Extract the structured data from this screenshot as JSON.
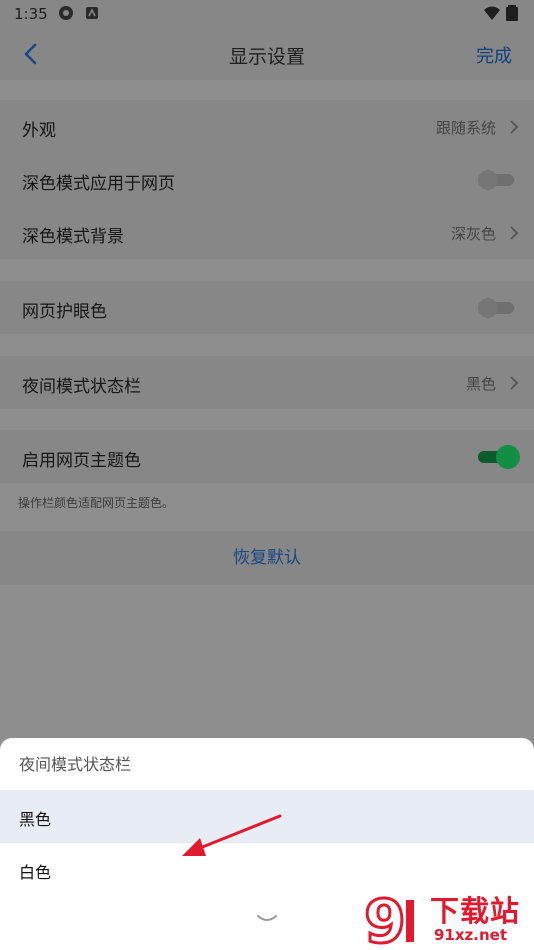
{
  "status_bar": {
    "time": "1:35"
  },
  "header": {
    "title": "显示设置",
    "done_label": "完成"
  },
  "group1": {
    "appearance": {
      "label": "外观",
      "value": "跟随系统"
    },
    "dark_web": {
      "label": "深色模式应用于网页",
      "enabled": false
    },
    "dark_bg": {
      "label": "深色模式背景",
      "value": "深灰色"
    }
  },
  "group2": {
    "eye_care": {
      "label": "网页护眼色",
      "enabled": false
    }
  },
  "group3": {
    "night_status_bar": {
      "label": "夜间模式状态栏",
      "value": "黑色"
    }
  },
  "group4": {
    "theme_color": {
      "label": "启用网页主题色",
      "enabled": true
    },
    "hint": "操作栏颜色适配网页主题色。"
  },
  "restore_label": "恢复默认",
  "sheet": {
    "title": "夜间模式状态栏",
    "options": [
      {
        "label": "黑色",
        "selected": true
      },
      {
        "label": "白色",
        "selected": false
      }
    ]
  },
  "watermark": {
    "brand": "下载站",
    "url": "91xz.net",
    "logo_text": "9"
  },
  "colors": {
    "accent": "#1e5fae",
    "toggle_on": "#148e44",
    "annotation_arrow": "#e21a30"
  }
}
